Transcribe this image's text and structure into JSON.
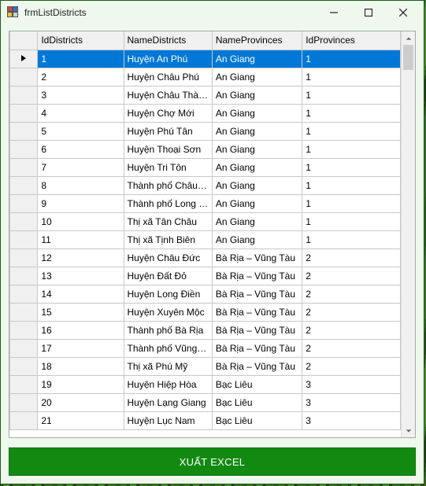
{
  "window": {
    "title": "frmListDistricts"
  },
  "grid": {
    "columns": {
      "idDistricts": "IdDistricts",
      "nameDistricts": "NameDistricts",
      "nameProvinces": "NameProvinces",
      "idProvinces": "IdProvinces"
    },
    "selected_index": 0,
    "rows": [
      {
        "id": "1",
        "name": "Huyện An Phú",
        "province": "An Giang",
        "province_id": "1"
      },
      {
        "id": "2",
        "name": "Huyện Châu Phú",
        "province": "An Giang",
        "province_id": "1"
      },
      {
        "id": "3",
        "name": "Huyện Châu Thành",
        "province": "An Giang",
        "province_id": "1"
      },
      {
        "id": "4",
        "name": "Huyện Chợ Mới",
        "province": "An Giang",
        "province_id": "1"
      },
      {
        "id": "5",
        "name": "Huyện Phú Tân",
        "province": "An Giang",
        "province_id": "1"
      },
      {
        "id": "6",
        "name": "Huyện Thoại Sơn",
        "province": "An Giang",
        "province_id": "1"
      },
      {
        "id": "7",
        "name": "Huyện Tri Tôn",
        "province": "An Giang",
        "province_id": "1"
      },
      {
        "id": "8",
        "name": "Thành phố Châu Đ...",
        "province": "An Giang",
        "province_id": "1"
      },
      {
        "id": "9",
        "name": "Thành phố Long X...",
        "province": "An Giang",
        "province_id": "1"
      },
      {
        "id": "10",
        "name": "Thị xã Tân Châu",
        "province": "An Giang",
        "province_id": "1"
      },
      {
        "id": "11",
        "name": "Thị xã Tịnh Biên",
        "province": "An Giang",
        "province_id": "1"
      },
      {
        "id": "12",
        "name": "Huyện Châu Đức",
        "province": "Bà Rịa – Vũng Tàu",
        "province_id": "2"
      },
      {
        "id": "13",
        "name": "Huyện Đất Đỏ",
        "province": "Bà Rịa – Vũng Tàu",
        "province_id": "2"
      },
      {
        "id": "14",
        "name": "Huyện Long Điền",
        "province": "Bà Rịa – Vũng Tàu",
        "province_id": "2"
      },
      {
        "id": "15",
        "name": "Huyện Xuyên Mộc",
        "province": "Bà Rịa – Vũng Tàu",
        "province_id": "2"
      },
      {
        "id": "16",
        "name": "Thành phố Bà Rịa",
        "province": "Bà Rịa – Vũng Tàu",
        "province_id": "2"
      },
      {
        "id": "17",
        "name": "Thành phố Vũng Tàu",
        "province": "Bà Rịa – Vũng Tàu",
        "province_id": "2"
      },
      {
        "id": "18",
        "name": "Thị xã Phú Mỹ",
        "province": "Bà Rịa – Vũng Tàu",
        "province_id": "2"
      },
      {
        "id": "19",
        "name": "Huyện Hiệp Hòa",
        "province": "Bạc Liêu",
        "province_id": "3"
      },
      {
        "id": "20",
        "name": "Huyện Lạng Giang",
        "province": "Bạc Liêu",
        "province_id": "3"
      },
      {
        "id": "21",
        "name": "Huyện Lục Nam",
        "province": "Bạc Liêu",
        "province_id": "3"
      }
    ]
  },
  "buttons": {
    "export_excel": "XUẤT EXCEL"
  }
}
